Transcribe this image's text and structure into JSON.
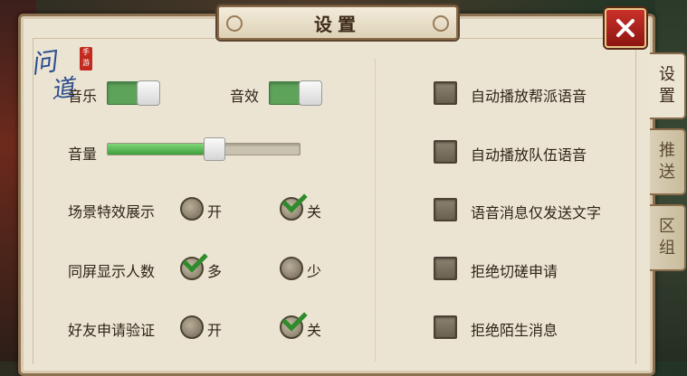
{
  "window": {
    "title": "设置"
  },
  "logo": {
    "text_line1": "问",
    "text_line2": "道",
    "badge": "手游"
  },
  "tabs": [
    {
      "label_top": "设",
      "label_bottom": "置",
      "active": true
    },
    {
      "label_top": "推",
      "label_bottom": "送",
      "active": false
    },
    {
      "label_top": "区",
      "label_bottom": "组",
      "active": false
    }
  ],
  "audio": {
    "music_label": "音乐",
    "music_on": true,
    "sfx_label": "音效",
    "sfx_on": true,
    "volume_label": "音量",
    "volume_level": 0.55
  },
  "options": {
    "scene_effects": {
      "label": "场景特效展示",
      "on_label": "开",
      "off_label": "关",
      "selected": "off"
    },
    "same_screen": {
      "label": "同屏显示人数",
      "many_label": "多",
      "few_label": "少",
      "selected": "many"
    },
    "friend_verify": {
      "label": "好友申请验证",
      "on_label": "开",
      "off_label": "关",
      "selected": "off"
    }
  },
  "checkboxes": [
    {
      "label": "自动播放帮派语音",
      "checked": false
    },
    {
      "label": "自动播放队伍语音",
      "checked": false
    },
    {
      "label": "语音消息仅发送文字",
      "checked": false
    },
    {
      "label": "拒绝切磋申请",
      "checked": false
    },
    {
      "label": "拒绝陌生消息",
      "checked": false
    }
  ],
  "colors": {
    "accent_green": "#5ea35a",
    "panel_bg": "#ebe4d3",
    "close_red": "#c9302a"
  }
}
